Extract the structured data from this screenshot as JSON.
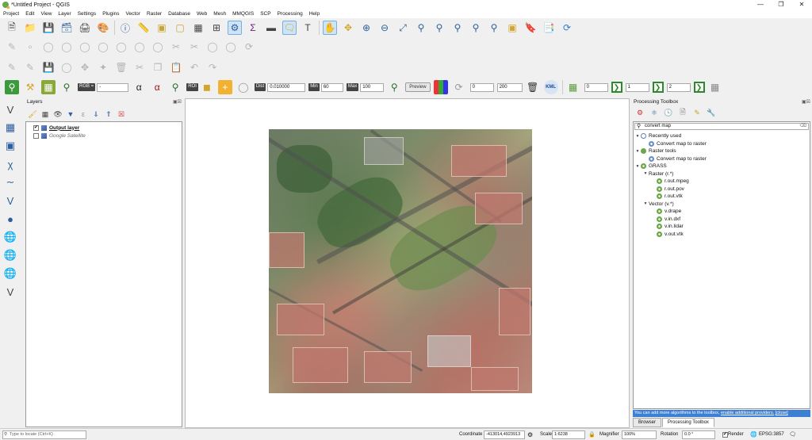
{
  "window": {
    "title": "*Untitled Project - QGIS",
    "controls": [
      "—",
      "❐",
      "✕"
    ]
  },
  "menu": [
    "Project",
    "Edit",
    "View",
    "Layer",
    "Settings",
    "Plugins",
    "Vector",
    "Raster",
    "Database",
    "Web",
    "Mesh",
    "MMQGIS",
    "SCP",
    "Processing",
    "Help"
  ],
  "scp_toolbar": {
    "rgb_label": "RGB =",
    "rgb_value": "-",
    "roi_label": "ROI",
    "dist_label": "Dist",
    "dist_value": "0.010000",
    "min_label": "Min",
    "min_value": "60",
    "max_label": "Max",
    "max_value": "100",
    "preview_label": "Preview",
    "range_start": "0",
    "range_end": "200",
    "kml_label": "KML",
    "band_a": "0",
    "band_b": "1",
    "band_c": "2"
  },
  "layers_panel": {
    "title": "Layers",
    "layers": [
      {
        "name": "Output layer",
        "checked": "✔"
      },
      {
        "name": "Google Satellite",
        "checked": ""
      }
    ]
  },
  "processing_toolbox": {
    "title": "Processing Toolbox",
    "search_value": "convert map",
    "tree": [
      {
        "level": 0,
        "arrow": "▼",
        "icon": "clock",
        "label": "Recently used"
      },
      {
        "level": 1,
        "arrow": "",
        "icon": "gear",
        "label": "Convert map to raster"
      },
      {
        "level": 0,
        "arrow": "▼",
        "icon": "qgis",
        "label": "Raster tools"
      },
      {
        "level": 1,
        "arrow": "",
        "icon": "gear",
        "label": "Convert map to raster"
      },
      {
        "level": 0,
        "arrow": "▼",
        "icon": "grass",
        "label": "GRASS"
      },
      {
        "level": 1,
        "arrow": "▼",
        "icon": "",
        "label": "Raster (r.*)"
      },
      {
        "level": 2,
        "arrow": "",
        "icon": "grass",
        "label": "r.out.mpeg"
      },
      {
        "level": 2,
        "arrow": "",
        "icon": "grass",
        "label": "r.out.pov"
      },
      {
        "level": 2,
        "arrow": "",
        "icon": "grass",
        "label": "r.out.vtk"
      },
      {
        "level": 1,
        "arrow": "▼",
        "icon": "",
        "label": "Vector (v.*)"
      },
      {
        "level": 2,
        "arrow": "",
        "icon": "grass",
        "label": "v.drape"
      },
      {
        "level": 2,
        "arrow": "",
        "icon": "grass",
        "label": "v.in.dxf"
      },
      {
        "level": 2,
        "arrow": "",
        "icon": "grass",
        "label": "v.in.lidar"
      },
      {
        "level": 2,
        "arrow": "",
        "icon": "grass",
        "label": "v.out.vtk"
      }
    ],
    "notice_text": "You can add more algorithms to the toolbox,",
    "notice_link": "enable additional providers.",
    "notice_close": "[close]"
  },
  "dock_tabs": [
    "Browser",
    "Processing Toolbox"
  ],
  "statusbar": {
    "locate_placeholder": "Type to locate (Ctrl+K)",
    "coordinate_label": "Coordinate",
    "coordinate_value": "-413014,4923913",
    "scale_label": "Scale",
    "scale_value": "1:6238",
    "magnifier_label": "Magnifier",
    "magnifier_value": "100%",
    "rotation_label": "Rotation",
    "rotation_value": "0.0 °",
    "render_label": "Render",
    "render_checked": "✔",
    "crs": "EPSG:3857"
  }
}
